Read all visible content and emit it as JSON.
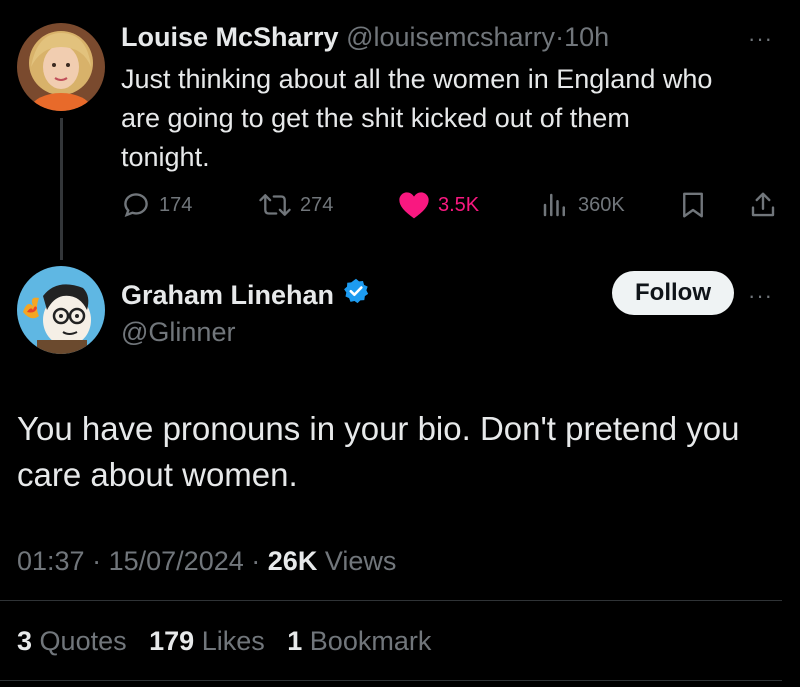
{
  "reply_tweet": {
    "author_name": "Louise McSharry",
    "handle": "@louisemcsharry",
    "separator": "·",
    "time": "10h",
    "text_lines": [
      "Just thinking about all the women in England who",
      "are going to get the shit kicked out of them",
      "tonight."
    ],
    "actions": {
      "replies": "174",
      "retweets": "274",
      "likes": "3.5K",
      "views": "360K"
    },
    "like_color": "#f91880"
  },
  "main_tweet": {
    "author_name": "Graham Linehan",
    "handle": "@Glinner",
    "verified_color": "#1d9bf0",
    "follow_label": "Follow",
    "text_lines": [
      "You have pronouns in your bio. Don't pretend you",
      "care about women."
    ],
    "meta": {
      "time": "01:37",
      "sep1": "·",
      "date": "15/07/2024",
      "sep2": "·",
      "views_count": "26K",
      "views_label": "Views"
    },
    "stats": {
      "quotes_count": "3",
      "quotes_label": "Quotes",
      "likes_count": "179",
      "likes_label": "Likes",
      "bookmarks_count": "1",
      "bookmarks_label": "Bookmark"
    }
  },
  "icons": {
    "more": "more-icon",
    "reply": "reply-icon",
    "retweet": "retweet-icon",
    "like": "heart-icon",
    "views": "views-icon",
    "bookmark": "bookmark-icon",
    "share": "share-icon",
    "verified": "verified-badge-icon"
  }
}
